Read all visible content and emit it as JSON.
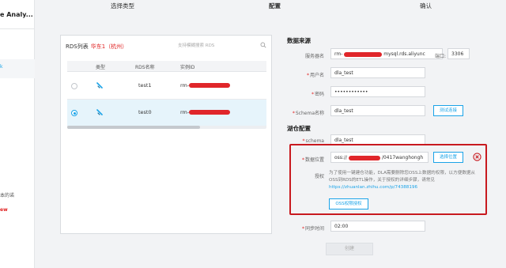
{
  "sidebar": {
    "title": "e Analy...",
    "active_tab": "k",
    "text_1": "本的诺",
    "text_2": "ew"
  },
  "steps": [
    "选择类型",
    "配置",
    "确认"
  ],
  "rds_panel": {
    "title": "RDS列表",
    "region": "华东1（杭州）",
    "search_placeholder": "支持模糊搜索 RDS",
    "columns": [
      "类型",
      "RDS名称",
      "实例ID"
    ],
    "rows": [
      {
        "name": "test1",
        "instance_prefix": "rm-",
        "selected": false
      },
      {
        "name": "test0",
        "instance_prefix": "rm-",
        "selected": true
      }
    ]
  },
  "form": {
    "data_source_title": "数据来源",
    "service_address_label": "服务器名",
    "service_address_prefix": "rm-",
    "service_address_suffix": "mysql.rds.aliyunc",
    "port_label": "端口:",
    "port_value": "3306",
    "username_label": "用户名",
    "username_value": "dla_test",
    "password_label": "密码",
    "password_value": "••••••••••••",
    "schema_label": "Schema名称",
    "schema_value": "dla_test",
    "test_button": "测试连接",
    "lake_config_title": "湖仓配置",
    "schema2_label": "schema",
    "schema2_value": "dla_test",
    "data_location_label": "数据位置",
    "data_location_prefix": "oss://",
    "data_location_suffix": "/0417wanghongh",
    "select_location_button": "选择位置",
    "auth_label": "授权",
    "auth_text": "为了使用一键建仓功能，DLA需要删除您OSS上数据的权限，以方便数据从OSS到RDS的ETL操作，关于授权的详细步骤，请常见",
    "auth_link": "https://zhuanlan.zhihu.com/p/74388196",
    "oss_auth_button": "OSS权限授权",
    "sync_time_label": "同步时间",
    "sync_time_value": "02:00",
    "create_button": "创建"
  },
  "colors": {
    "accent": "#1aa3e8",
    "highlight_red": "#c8191f",
    "redaction": "#e0262a"
  }
}
